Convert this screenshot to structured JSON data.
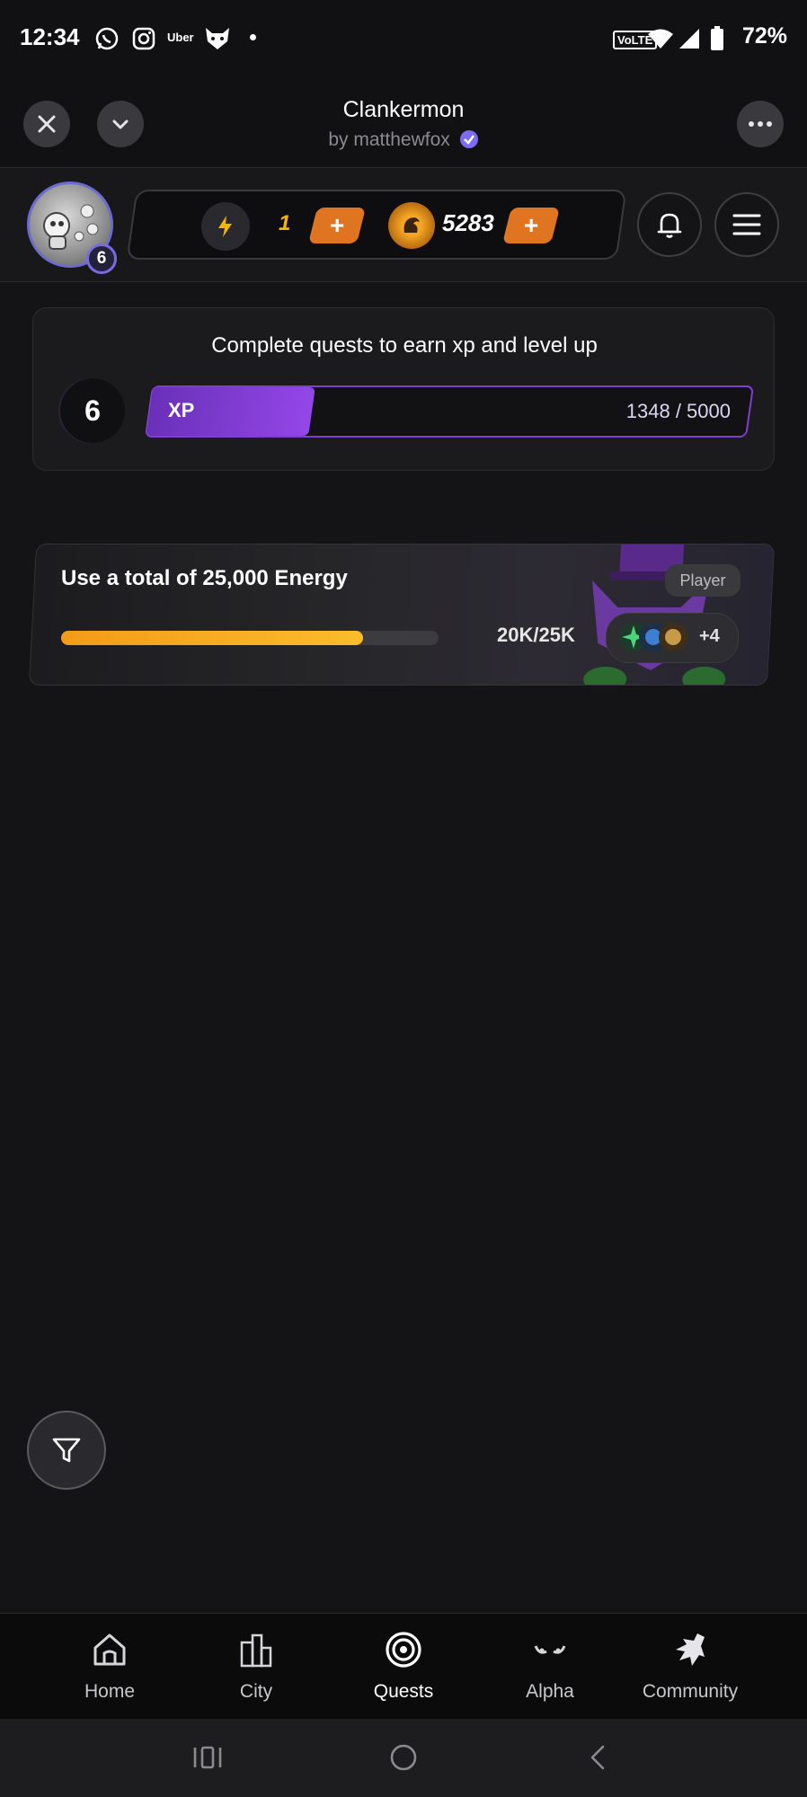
{
  "status_bar": {
    "time": "12:34",
    "left_icons": [
      "whatsapp-icon",
      "instagram-icon",
      "uber-icon",
      "fox-icon",
      "dot-icon"
    ],
    "uber_text": "Uber",
    "volte": "VoLTE",
    "battery": "72%"
  },
  "mini_app": {
    "title": "Clankermon",
    "author": "by matthewfox"
  },
  "top_bar": {
    "avatar_level": "6",
    "energy": "1",
    "coins": "5283",
    "plus_label": "+"
  },
  "xp_card": {
    "title": "Complete quests to earn xp and level up",
    "level": "6",
    "xp_label": "XP",
    "xp_value": "1348 / 5000",
    "xp_current": 1348,
    "xp_max": 5000
  },
  "quests": [
    {
      "title": "Use a total of 25,000 Energy",
      "tag": "Player",
      "progress_text": "20K/25K",
      "progress_current": 20000,
      "progress_max": 25000,
      "extra_rewards": "+4"
    }
  ],
  "bottom_nav": {
    "items": [
      {
        "label": "Home",
        "icon": "home-icon"
      },
      {
        "label": "City",
        "icon": "city-icon"
      },
      {
        "label": "Quests",
        "icon": "target-icon",
        "active": true
      },
      {
        "label": "Alpha",
        "icon": "eyes-icon"
      },
      {
        "label": "Community",
        "icon": "wolf-icon"
      }
    ]
  },
  "colors": {
    "background": "#141416",
    "accent_purple": "#8a43e0",
    "accent_orange": "#e07521",
    "progress_yellow": "#fbbc2b"
  }
}
